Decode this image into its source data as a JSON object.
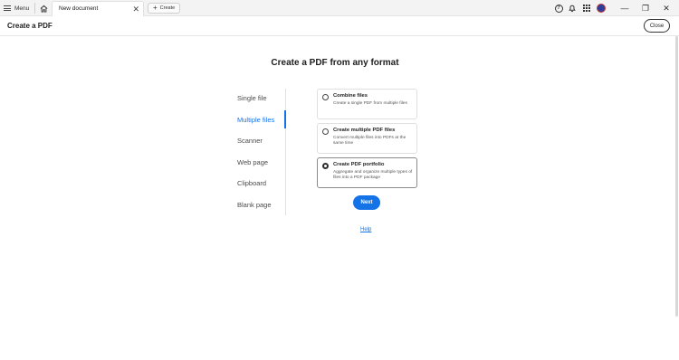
{
  "titlebar": {
    "menu_label": "Menu",
    "tab_label": "New document",
    "tab_close": "✕",
    "create_label": "Create",
    "create_plus": "+",
    "window_controls": [
      "—",
      "❐",
      "✕"
    ]
  },
  "header": {
    "title": "Create a PDF",
    "close_label": "Close"
  },
  "main": {
    "title": "Create a PDF from any format",
    "nav": [
      {
        "label": "Single file"
      },
      {
        "label": "Multiple files"
      },
      {
        "label": "Scanner"
      },
      {
        "label": "Web page"
      },
      {
        "label": "Clipboard"
      },
      {
        "label": "Blank page"
      }
    ],
    "active_nav": "Multiple files",
    "options": [
      {
        "title": "Combine files",
        "desc": "Create a single PDF from multiple files",
        "selected": false
      },
      {
        "title": "Create multiple PDF files",
        "desc": "Convert multiple files into PDFs at the same time",
        "selected": false
      },
      {
        "title": "Create PDF portfolio",
        "desc": "Aggregate and organize multiple types of files into a PDF package",
        "selected": true
      }
    ],
    "next_label": "Next",
    "help_label": "Help"
  },
  "colors": {
    "accent": "#1473e6",
    "avatar": "#2d3e9a"
  },
  "icons": [
    "hamburger-icon",
    "home-icon",
    "help-icon",
    "bell-icon",
    "apps-icon",
    "avatar-icon"
  ]
}
